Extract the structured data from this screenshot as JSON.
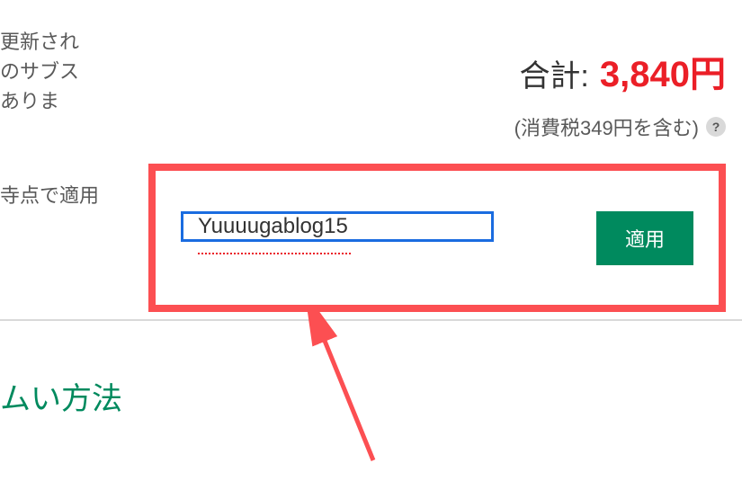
{
  "top_text_fragments": {
    "line1": "更新され",
    "line2": "のサブス",
    "line3": "ありま"
  },
  "side_text": "寺点で適用",
  "total": {
    "label": "合計:",
    "amount": "3,840円"
  },
  "tax": {
    "text": "(消費税349円を含む)"
  },
  "promo": {
    "value": "Yuuuugablog15",
    "apply_label": "適用"
  },
  "section_heading": "ムい方法",
  "icons": {
    "help": "?"
  }
}
